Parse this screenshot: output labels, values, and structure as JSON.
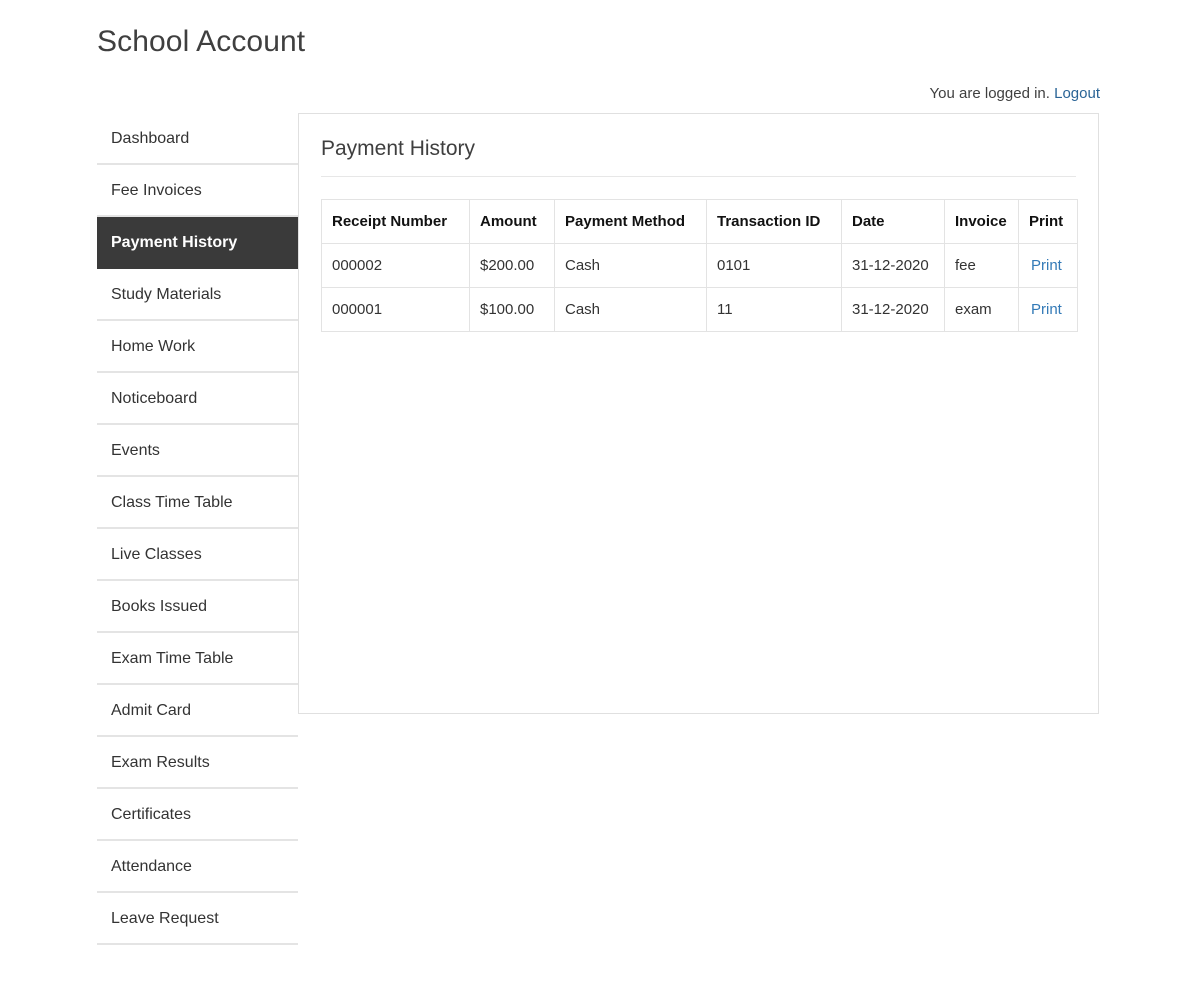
{
  "header": {
    "site_title": "School Account",
    "status_text": "You are logged in.",
    "logout_label": "Logout"
  },
  "sidebar": {
    "items": [
      {
        "label": "Dashboard",
        "active": false
      },
      {
        "label": "Fee Invoices",
        "active": false
      },
      {
        "label": "Payment History",
        "active": true
      },
      {
        "label": "Study Materials",
        "active": false
      },
      {
        "label": "Home Work",
        "active": false
      },
      {
        "label": "Noticeboard",
        "active": false
      },
      {
        "label": "Events",
        "active": false
      },
      {
        "label": "Class Time Table",
        "active": false
      },
      {
        "label": "Live Classes",
        "active": false
      },
      {
        "label": "Books Issued",
        "active": false
      },
      {
        "label": "Exam Time Table",
        "active": false
      },
      {
        "label": "Admit Card",
        "active": false
      },
      {
        "label": "Exam Results",
        "active": false
      },
      {
        "label": "Certificates",
        "active": false
      },
      {
        "label": "Attendance",
        "active": false
      },
      {
        "label": "Leave Request",
        "active": false
      }
    ]
  },
  "main": {
    "panel_title": "Payment History",
    "table": {
      "columns": [
        "Receipt Number",
        "Amount",
        "Payment Method",
        "Transaction ID",
        "Date",
        "Invoice",
        "Print"
      ],
      "rows": [
        {
          "receipt_number": "000002",
          "amount": "$200.00",
          "payment_method": "Cash",
          "transaction_id": "0101",
          "date": "31-12-2020",
          "invoice": "fee",
          "print_label": "Print"
        },
        {
          "receipt_number": "000001",
          "amount": "$100.00",
          "payment_method": "Cash",
          "transaction_id": "11",
          "date": "31-12-2020",
          "invoice": "exam",
          "print_label": "Print"
        }
      ]
    }
  },
  "colors": {
    "link": "#337ab7",
    "active_nav_bg": "#3a3a3a",
    "border": "#e3e3e3",
    "text": "#333333"
  }
}
